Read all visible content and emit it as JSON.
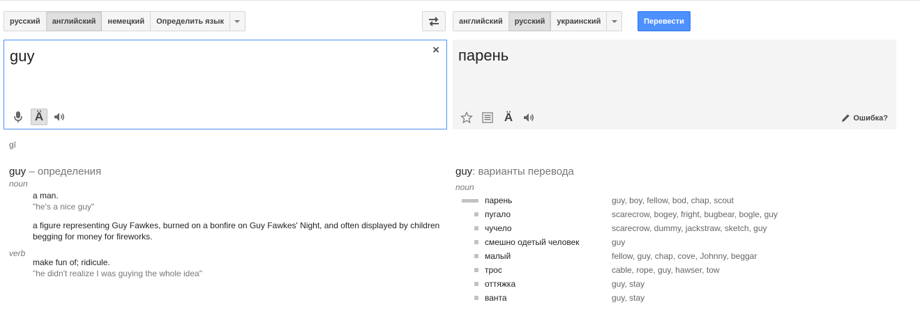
{
  "source_langs": {
    "items": [
      "русский",
      "английский",
      "немецкий",
      "Определить язык"
    ],
    "selected": 1
  },
  "target_langs": {
    "items": [
      "английский",
      "русский",
      "украинский"
    ],
    "selected": 1
  },
  "translate_button": "Перевести",
  "source": {
    "text": "guy",
    "clear_symbol": "×"
  },
  "target": {
    "text": "парень",
    "fix_link": "Ошибка?"
  },
  "transliteration": "gī",
  "definitions": {
    "word": "guy",
    "heading_suffix": " – определения",
    "groups": [
      {
        "pos": "noun",
        "entries": [
          {
            "def": "a man.",
            "example": "\"he's a nice guy\""
          },
          {
            "def": "a figure representing Guy Fawkes, burned on a bonfire on Guy Fawkes' Night, and often displayed by children begging for money for fireworks.",
            "example": ""
          }
        ]
      },
      {
        "pos": "verb",
        "entries": [
          {
            "def": "make fun of; ridicule.",
            "example": "\"he didn't realize I was guying the whole idea\""
          }
        ]
      }
    ]
  },
  "translations": {
    "word": "guy",
    "heading_suffix": ": варианты перевода",
    "pos": "noun",
    "rows": [
      {
        "word": "парень",
        "synonyms": "guy, boy, fellow, bod, chap, scout",
        "frequency": 1.0
      },
      {
        "word": "пугало",
        "synonyms": "scarecrow, bogey, fright, bugbear, bogle, guy",
        "frequency": 0.2
      },
      {
        "word": "чучело",
        "synonyms": "scarecrow, dummy, jackstraw, sketch, guy",
        "frequency": 0.2
      },
      {
        "word": "смешно одетый человек",
        "synonyms": "guy",
        "frequency": 0.2
      },
      {
        "word": "малый",
        "synonyms": "fellow, guy, chap, cove, Johnny, beggar",
        "frequency": 0.2
      },
      {
        "word": "трос",
        "synonyms": "cable, rope, guy, hawser, tow",
        "frequency": 0.2
      },
      {
        "word": "оттяжка",
        "synonyms": "guy, stay",
        "frequency": 0.2
      },
      {
        "word": "ванта",
        "synonyms": "guy, stay",
        "frequency": 0.2
      }
    ]
  },
  "icons": {
    "mic": "microphone-icon",
    "keyboard": "input-tools-icon",
    "speaker": "speaker-icon",
    "star": "star-icon",
    "list": "list-icon",
    "swap": "swap-languages-icon",
    "pencil": "pencil-icon"
  },
  "colors": {
    "accent": "#4d90fe",
    "freq_bar": "#c2c2c2"
  }
}
